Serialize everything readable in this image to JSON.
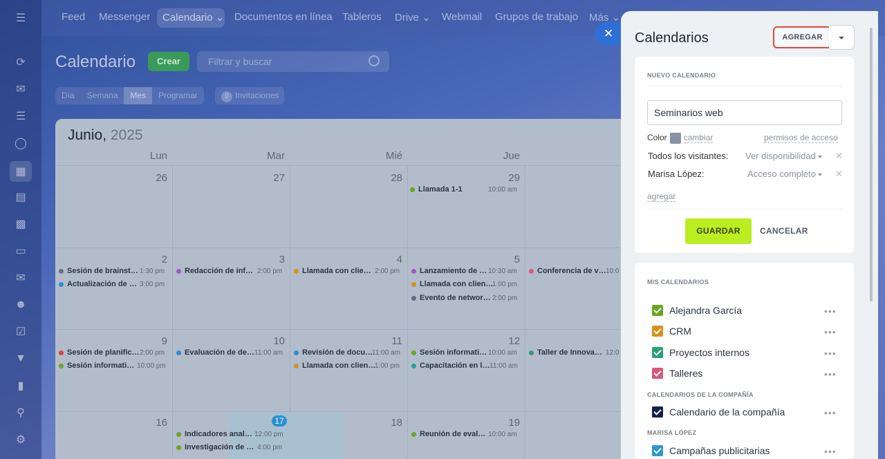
{
  "topnav": {
    "items": [
      "Feed",
      "Messenger",
      "Calendario",
      "Documentos en línea",
      "Tableros",
      "Drive",
      "Webmail",
      "Grupos de trabajo",
      "Más"
    ]
  },
  "page": {
    "title": "Calendario",
    "create_label": "Crear",
    "filter_placeholder": "Filtrar y buscar",
    "view_tabs": [
      "Día",
      "Semana",
      "Mes",
      "Programar"
    ],
    "active_tab": "Mes",
    "invitations_count": "0",
    "invitations_label": "Invitaciones"
  },
  "calendar": {
    "month": "Junio,",
    "year": "2025",
    "weekdays": [
      "Lun",
      "Mar",
      "Mié",
      "Jue"
    ],
    "week1": [
      "26",
      "27",
      "28",
      "29"
    ],
    "week2": [
      "2",
      "3",
      "4",
      "5"
    ],
    "week3": [
      "9",
      "10",
      "11",
      "12"
    ],
    "week4": [
      "16",
      "17",
      "18",
      "19"
    ],
    "events": {
      "w1": {
        "jue": {
          "title": "Llamada 1-1",
          "time": "10:00 am"
        }
      },
      "w2": {
        "lun": [
          {
            "title": "Sesión de brainst…",
            "time": "1:30 pm"
          },
          {
            "title": "Actualización de …",
            "time": "3:00 pm"
          }
        ],
        "mar": {
          "title": "Redacción de inf…",
          "time": "2:00 pm"
        },
        "mie": {
          "title": "Llamada con clie…",
          "time": "2:00 pm"
        },
        "jue": [
          {
            "title": "Lanzamiento de …",
            "time": "10:30 am"
          },
          {
            "title": "Llamada con clien…",
            "time": "1:00 pm"
          },
          {
            "title": "Evento de networ…",
            "time": "2:00 pm"
          }
        ],
        "vie": {
          "title": "Conferencia de v…",
          "time": "10:0"
        }
      },
      "w3": {
        "lun": [
          {
            "title": "Sesión de planific…",
            "time": "2:00 pm"
          },
          {
            "title": "Sesión informati…",
            "time": "10:00 pm"
          }
        ],
        "mar": {
          "title": "Evaluación de de…",
          "time": "11:00 am"
        },
        "mie": [
          {
            "title": "Revisión de docu…",
            "time": "11:00 am"
          },
          {
            "title": "Llamada con clien…",
            "time": "1:00 pm"
          }
        ],
        "jue": [
          {
            "title": "Sesión informati…",
            "time": "10:00 am"
          },
          {
            "title": "Capacitación en l…",
            "time": "11:00 am"
          }
        ],
        "vie": {
          "title": "Taller de Innova…",
          "time": "12:0"
        }
      },
      "w4": {
        "mar": [
          {
            "title": "Indicadores anal…",
            "time": "12:00 pm"
          },
          {
            "title": "Investigación de …",
            "time": "4:00 pm"
          }
        ],
        "jue": {
          "title": "Reunión de eval…",
          "time": "10:00 am"
        }
      }
    }
  },
  "panel": {
    "title": "Calendarios",
    "add_label": "AGREGAR",
    "new_section": "NUEVO CALENDARIO",
    "name_value": "Seminarios web",
    "color_label": "Color",
    "change_label": "cambiar",
    "access_label": "permisos de acceso",
    "perm1_who": "Todos los visitantes:",
    "perm1_level": "Ver disponibilidad",
    "perm2_who": "Marisa López:",
    "perm2_level": "Acceso completo",
    "add_link": "agregar",
    "save_label": "GUARDAR",
    "cancel_label": "CANCELAR",
    "my_section": "MIS CALENDARIOS",
    "my": [
      {
        "name": "Alejandra García",
        "color": "#6aa521"
      },
      {
        "name": "CRM",
        "color": "#d9901c"
      },
      {
        "name": "Proyectos internos",
        "color": "#2aa175"
      },
      {
        "name": "Talleres",
        "color": "#d9577a"
      }
    ],
    "company_section": "CALENDARIOS DE LA COMPAÑÍA",
    "company": [
      {
        "name": "Calendario de la compañía",
        "color": "#0f2248"
      }
    ],
    "user_section": "MARISA LÓPEZ",
    "user": [
      {
        "name": "Campañas publicitarias",
        "color": "#2e97d4"
      }
    ]
  }
}
